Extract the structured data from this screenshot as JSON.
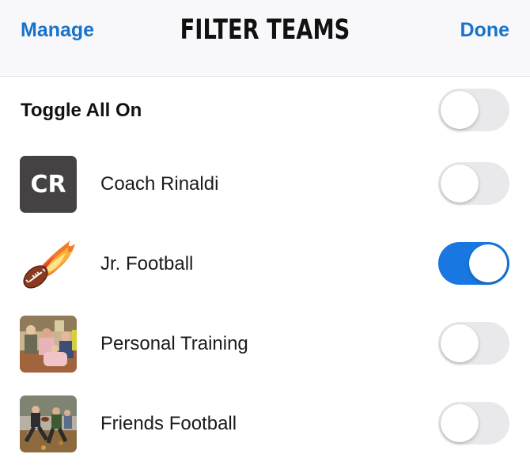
{
  "header": {
    "left_button": "Manage",
    "title": "FILTER TEAMS",
    "right_button": "Done"
  },
  "toggle_all": {
    "label": "Toggle All On",
    "on": false
  },
  "teams": [
    {
      "label": "Coach Rinaldi",
      "avatar_type": "initials",
      "initials": "CR",
      "on": false
    },
    {
      "label": "Jr. Football",
      "avatar_type": "flaming-football-icon",
      "on": true
    },
    {
      "label": "Personal Training",
      "avatar_type": "photo",
      "on": false
    },
    {
      "label": "Friends Football",
      "avatar_type": "photo",
      "on": false
    }
  ],
  "colors": {
    "accent": "#1a73c9",
    "toggle_on": "#1877e0",
    "toggle_off": "#e9e9eb",
    "header_bg": "#f8f7fa",
    "initials_bg": "#454244"
  }
}
